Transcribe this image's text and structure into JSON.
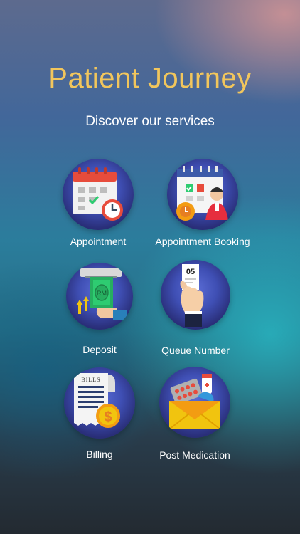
{
  "header": {
    "title": "Patient Journey",
    "subtitle": "Discover our services"
  },
  "services": [
    {
      "label": "Appointment",
      "icon": "calendar-clock-icon"
    },
    {
      "label": "Appointment Booking",
      "icon": "booking-calendar-doctor-icon"
    },
    {
      "label": "Deposit",
      "icon": "cash-deposit-icon"
    },
    {
      "label": "Queue Number",
      "icon": "queue-ticket-icon",
      "ticket_number": "05"
    },
    {
      "label": "Billing",
      "icon": "bill-coin-icon",
      "bill_text": "BILLS",
      "coin_symbol": "$"
    },
    {
      "label": "Post Medication",
      "icon": "medicine-envelope-icon"
    }
  ],
  "colors": {
    "title": "#f2c65c",
    "circle": "#3f4fb4"
  }
}
